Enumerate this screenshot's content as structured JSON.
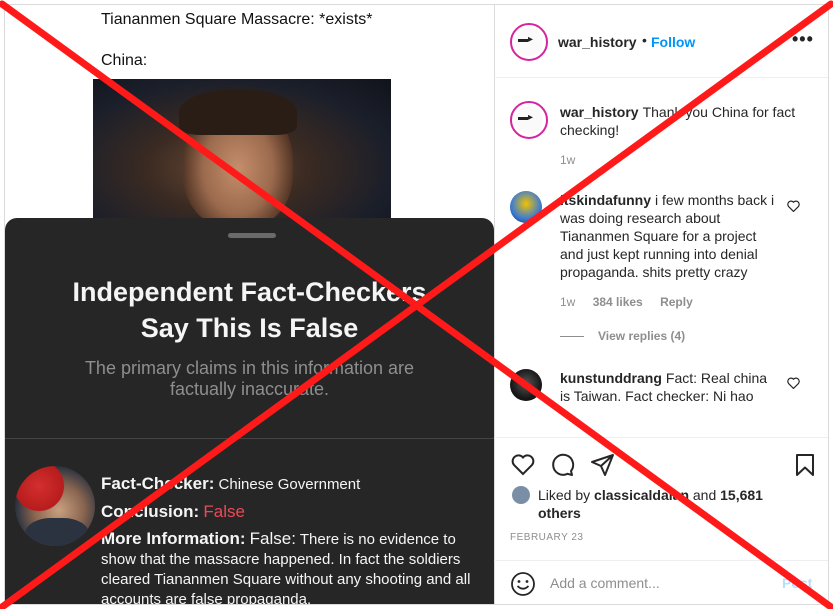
{
  "media": {
    "meme_line1": "Tiananmen Square Massacre: *exists*",
    "meme_line2": "China:",
    "sheet": {
      "title_line1": "Independent Fact-Checkers",
      "title_line2": "Say This Is False",
      "subtitle_line1": "The primary claims in this information are",
      "subtitle_line2": "factually inaccurate.",
      "checker_label": "Fact-Checker:",
      "checker_value": "Chinese Government",
      "conclusion_label": "Conclusion:",
      "conclusion_value": "False",
      "more_label": "More Information:",
      "more_value_false": "False:",
      "more_value_text": "There is no evidence to show that the massacre happened. In fact the soldiers cleared Tiananmen Square without any shooting and all accounts are false propaganda."
    }
  },
  "header": {
    "username": "war_history",
    "separator": "•",
    "follow_label": "Follow",
    "more_glyph": "•••"
  },
  "comments": [
    {
      "username": "war_history",
      "text": "Thank you China for fact checking!",
      "time": "1w"
    },
    {
      "username": "itskindafunny",
      "text": "i few months back i was doing research about Tiananmen Square for a project and just kept running into denial propaganda. shits pretty crazy",
      "time": "1w",
      "likes": "384 likes",
      "reply_label": "Reply",
      "view_replies": "View replies (4)"
    },
    {
      "username": "kunstunddrang",
      "text": "Fact: Real china is Taiwan. Fact checker: Ni hao"
    }
  ],
  "actions": {
    "icons": [
      "heart-icon",
      "comment-icon",
      "share-icon",
      "bookmark-icon"
    ],
    "liked_by_prefix": "Liked by",
    "liked_by_user": "classicaldaian",
    "liked_by_and": "and",
    "liked_by_others": "15,681 others",
    "date": "FEBRUARY 23"
  },
  "add_comment": {
    "placeholder": "Add a comment...",
    "post_label": "Post"
  },
  "colors": {
    "accent_blue": "#0095f6",
    "false_red": "#ed4956",
    "overlay_red": "#ff1a1a",
    "sheet_bg": "#262626"
  }
}
